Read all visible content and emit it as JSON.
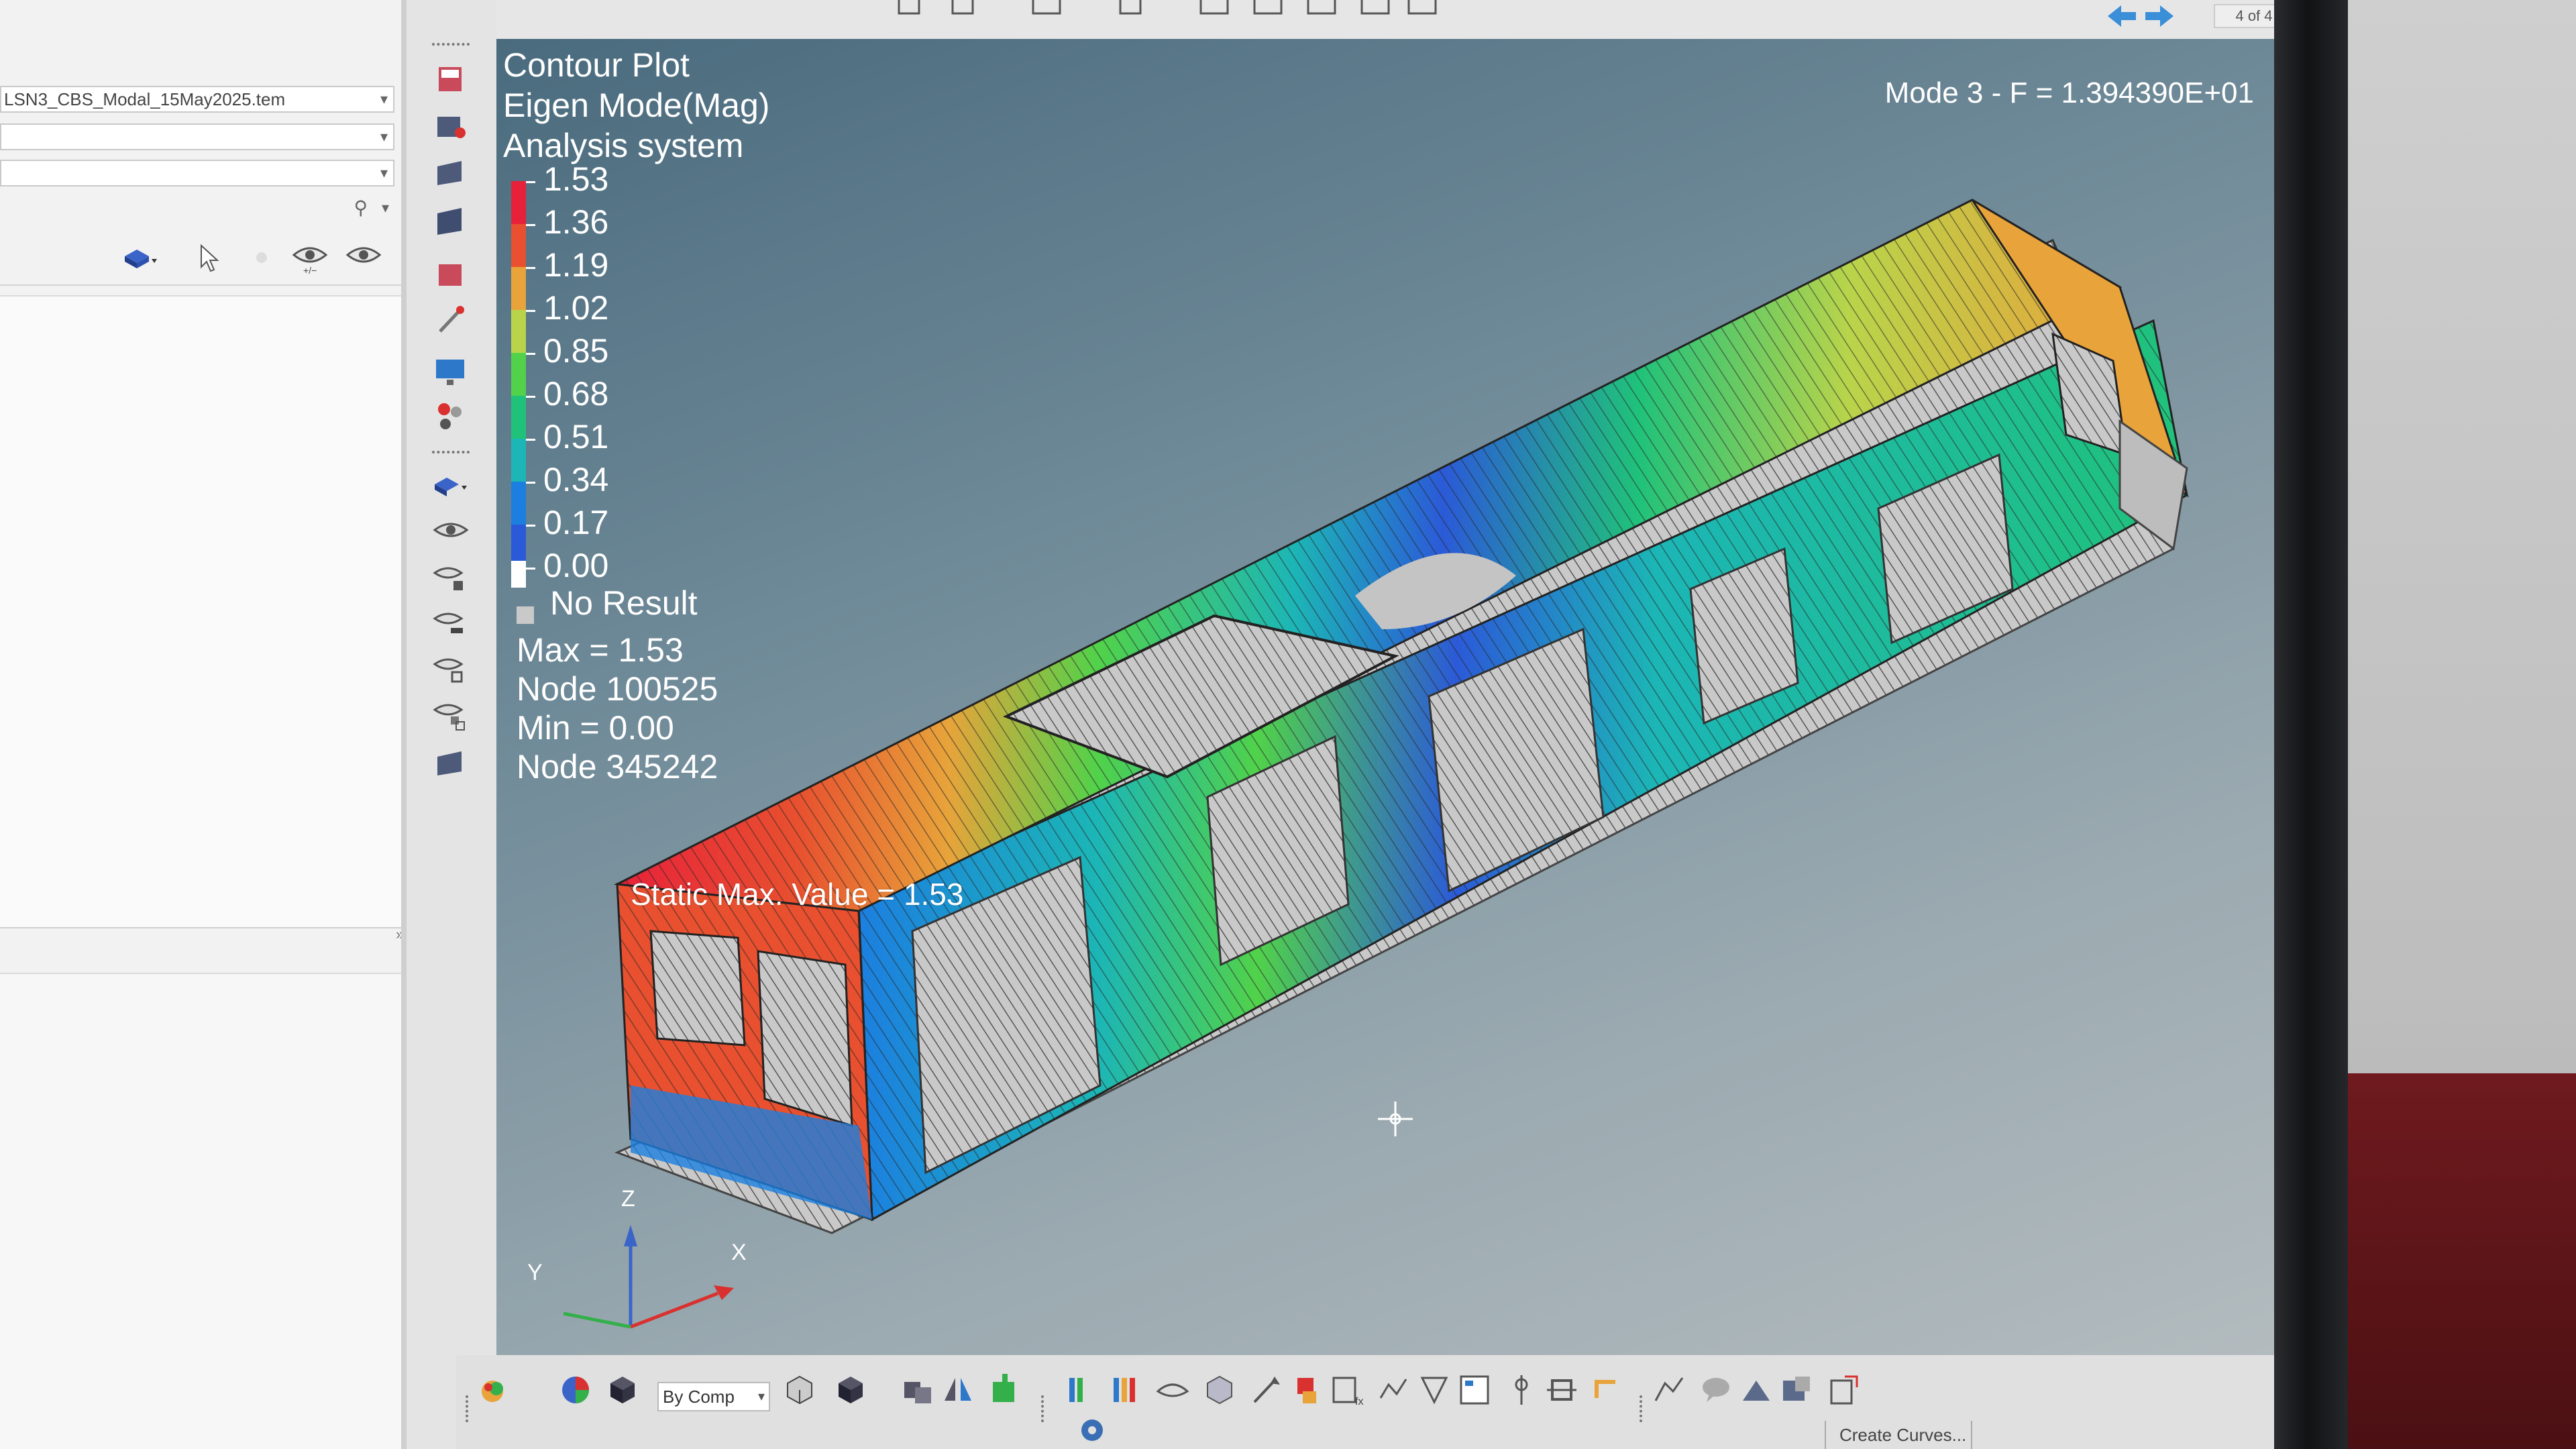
{
  "left_panel": {
    "file_combo": "LSN3_CBS_Modal_15May2025.tem",
    "combo2": "",
    "combo3": "",
    "search_placeholder": "",
    "tools": [
      "component-icon",
      "select-cursor-icon",
      "eye-add-remove-icon",
      "eye-icon"
    ]
  },
  "contour_legend": {
    "title_lines": [
      "Contour Plot",
      "Eigen Mode(Mag)",
      "Analysis system"
    ],
    "ticks": [
      "1.53",
      "1.36",
      "1.19",
      "1.02",
      "0.85",
      "0.68",
      "0.51",
      "0.34",
      "0.17",
      "0.00"
    ],
    "colors": [
      "#e8213a",
      "#e8502f",
      "#e8a33a",
      "#b9d44a",
      "#51d24a",
      "#20c27a",
      "#1cb6b6",
      "#1c7fe0",
      "#2b5ad8",
      "#ffffff"
    ],
    "no_result_label": "No Result",
    "no_result_color": "#c9c9c9",
    "max_line": "Max = 1.53",
    "max_node": "Node 100525",
    "min_line": "Min = 0.00",
    "min_node": "Node 345242"
  },
  "mode_label": "Mode 3 - F = 1.394390E+01",
  "static_max_label": "Static Max. Value =  1.53",
  "triad": {
    "z": "Z",
    "y": "Y",
    "x": "X"
  },
  "bottom_toolbar": {
    "by_comp": "By Comp",
    "create_curves": "Create Curves..."
  },
  "nav": {
    "page": "4 of 4"
  }
}
